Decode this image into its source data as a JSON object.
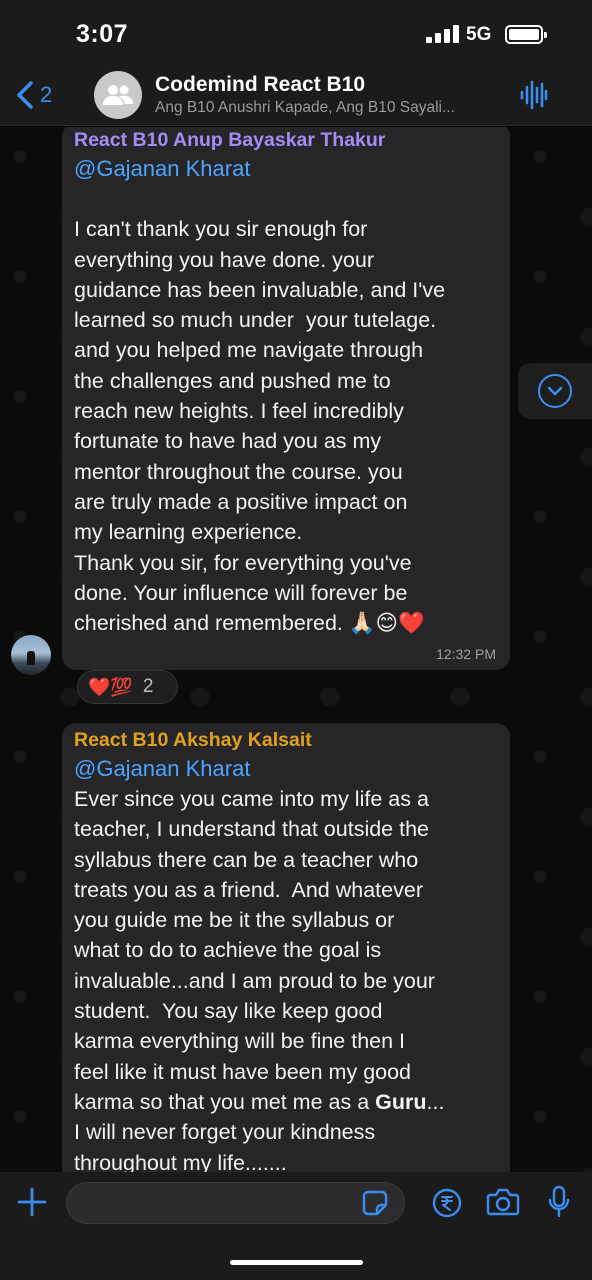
{
  "status_bar": {
    "time": "3:07",
    "network": "5G"
  },
  "header": {
    "back_count": "2",
    "title": "Codemind React B10",
    "subtitle": "Ang B10 Anushri Kapade, Ang B10 Sayali..."
  },
  "messages": [
    {
      "sender": "React B10 Anup Bayaskar Thakur",
      "sender_color": "#a58cf5",
      "mention": "@Gajanan Kharat",
      "text": "\nI can't thank you sir enough for\neverything you have done. your\nguidance has been invaluable, and I've\nlearned so much under  your tutelage.\nand you helped me navigate through\nthe challenges and pushed me to\nreach new heights. I feel incredibly\nfortunate to have had you as my\nmentor throughout the course. you\nare truly made a positive impact on\nmy learning experience.\nThank you sir, for everything you've\ndone. Your influence will forever be\ncherished and remembered. 🙏🏻😊❤️",
      "time": "12:32 PM",
      "reactions": {
        "emojis": "❤️💯",
        "count": "2"
      }
    },
    {
      "sender": "React B10 Akshay Kalsait",
      "sender_color": "#e0a21c",
      "mention": "@Gajanan Kharat",
      "text_before_bold": "Ever since you came into my life as a\nteacher, I understand that outside the\nsyllabus there can be a teacher who\ntreats you as a friend.  And whatever\nyou guide me be it the syllabus or\nwhat to do to achieve the goal is\ninvaluable...and I am proud to be your\nstudent.  You say like keep good\nkarma everything will be fine then I\nfeel like it must have been my good\nkarma so that you met me as a ",
      "bold_text": "Guru",
      "text_after_bold": "...\nI will never forget your kindness\nthroughout my life......."
    }
  ],
  "input": {
    "placeholder": "",
    "value": ""
  },
  "colors": {
    "accent": "#3b8df0",
    "bubble": "#262628",
    "background": "#0b0b0b",
    "mention": "#4ea3ff"
  }
}
